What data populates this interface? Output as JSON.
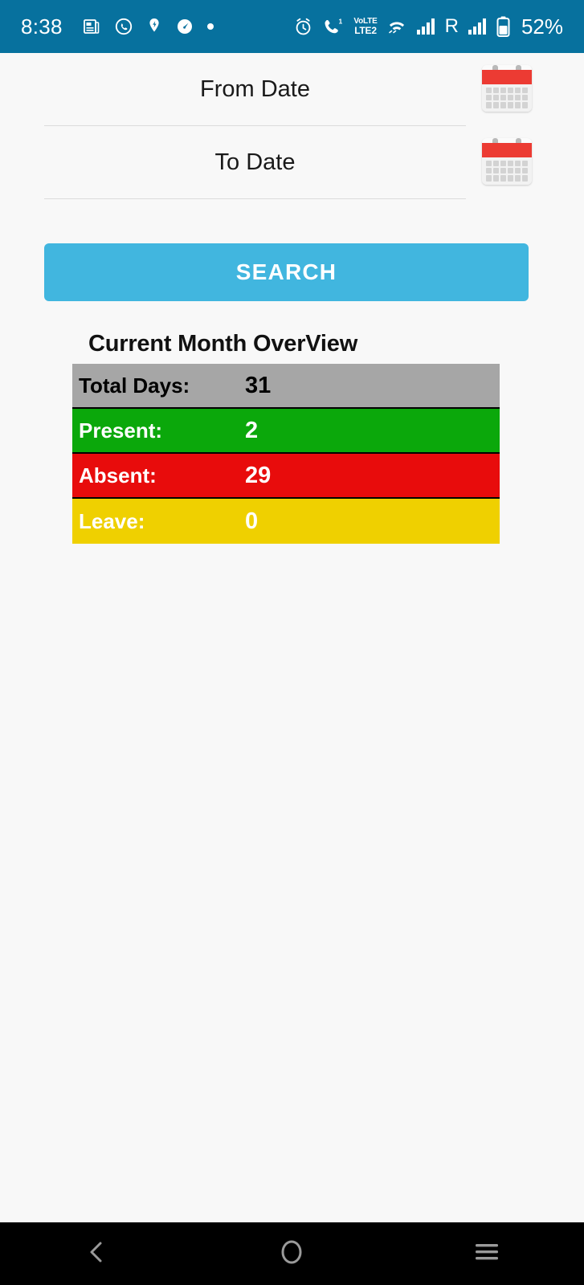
{
  "status_bar": {
    "time": "8:38",
    "battery_percent": "52%",
    "background_color": "#07719e",
    "left_icons": [
      {
        "name": "news-document-icon",
        "glyph": "doc"
      },
      {
        "name": "whatsapp-icon",
        "glyph": "whatsapp"
      },
      {
        "name": "location-pin-icon",
        "glyph": "pin"
      },
      {
        "name": "speedometer-icon",
        "glyph": "speed"
      },
      {
        "name": "dot-indicator-icon",
        "glyph": "dot"
      }
    ],
    "right_icons": [
      {
        "name": "alarm-clock-icon",
        "glyph": "alarm"
      },
      {
        "name": "missed-call-icon",
        "glyph": "call",
        "badge": "1"
      },
      {
        "name": "volte-icon",
        "line1": "VoLTE",
        "line2": "LTE2"
      },
      {
        "name": "wifi-calling-icon",
        "glyph": "wifi"
      },
      {
        "name": "signal-bars-icon-1",
        "glyph": "signal"
      },
      {
        "name": "roaming-indicator",
        "glyph": "R",
        "text": "R"
      },
      {
        "name": "signal-bars-icon-2",
        "glyph": "signal"
      },
      {
        "name": "battery-icon",
        "glyph": "battery"
      }
    ]
  },
  "form": {
    "from_date": {
      "label": "From Date",
      "value": "",
      "placeholder": "From Date",
      "calendar_icon": "calendar-icon"
    },
    "to_date": {
      "label": "To Date",
      "value": "",
      "placeholder": "To Date",
      "calendar_icon": "calendar-icon"
    },
    "search_label": "SEARCH",
    "search_color": "#41b6df"
  },
  "overview": {
    "title": "Current Month OverView",
    "rows": [
      {
        "label": "Total Days:",
        "value": "31",
        "bg": "#a6a6a6",
        "fg": "#000000"
      },
      {
        "label": "Present:",
        "value": "2",
        "bg": "#0ba80b",
        "fg": "#ffffff"
      },
      {
        "label": "Absent:",
        "value": "29",
        "bg": "#e80c0c",
        "fg": "#ffffff"
      },
      {
        "label": "Leave:",
        "value": "0",
        "bg": "#efd000",
        "fg": "#ffffff"
      }
    ]
  },
  "nav_bar": {
    "back": "back-chevron-icon",
    "home": "home-circle-icon",
    "recents": "recents-menu-icon"
  }
}
